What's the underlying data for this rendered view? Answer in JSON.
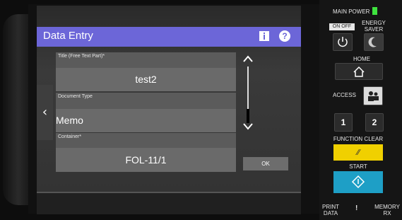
{
  "dialog": {
    "title": "Data Entry"
  },
  "fields": [
    {
      "label": "Title (Free Text Part)*",
      "value": "test2"
    },
    {
      "label": "Document Type",
      "value": "Memo"
    },
    {
      "label": "Container*",
      "value": "FOL-11/1"
    }
  ],
  "buttons": {
    "back": "‹",
    "ok": "OK",
    "help": "?"
  },
  "panel": {
    "main_power": "MAIN POWER",
    "on_off": "ON OFF",
    "energy_saver": "ENERGY SAVER",
    "home": "HOME",
    "access": "ACCESS",
    "key1": "1",
    "key2": "2",
    "function_clear": "FUNCTION CLEAR",
    "start": "START",
    "print_data": "PRINT DATA",
    "alert": "!",
    "memory_rx": "MEMORY RX"
  },
  "colors": {
    "title_bar": "#6c66d8",
    "function_clear": "#f0d000",
    "start": "#1e9fc6",
    "power_led": "#3ee23e"
  },
  "icons": [
    "info-icon",
    "help-icon",
    "chevron-left-icon",
    "chevron-up-icon",
    "chevron-down-icon",
    "power-icon",
    "moon-icon",
    "home-icon",
    "access-icon",
    "function-clear-icon",
    "start-icon"
  ]
}
